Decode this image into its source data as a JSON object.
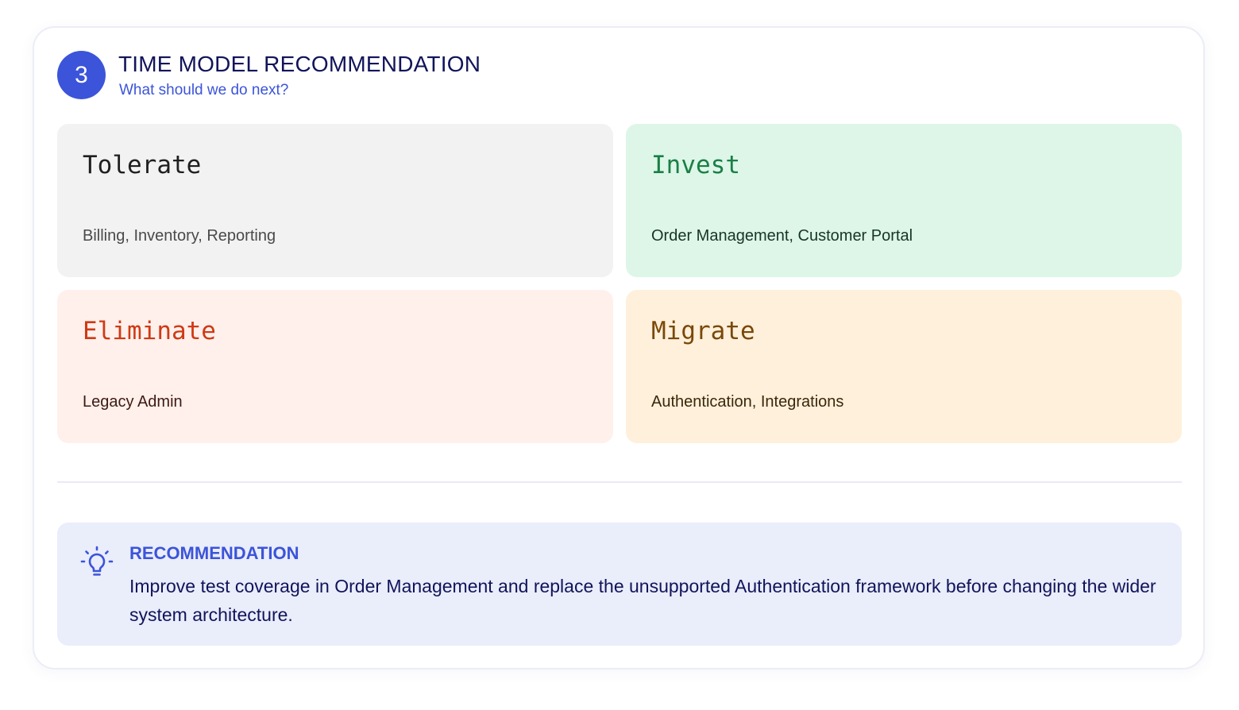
{
  "section": {
    "step_number": "3",
    "title": "TIME MODEL RECOMMENDATION",
    "subtitle": "What should we do next?"
  },
  "quadrants": [
    {
      "name": "Tolerate",
      "items": "Billing, Inventory, Reporting",
      "title_color": "#1f1f1f",
      "text_color": "#4a4a4a",
      "background": "#f2f2f2"
    },
    {
      "name": "Invest",
      "items": "Order Management, Customer Portal",
      "title_color": "#1b7f45",
      "text_color": "#173526",
      "background": "#ddf6e8"
    },
    {
      "name": "Eliminate",
      "items": "Legacy Admin",
      "title_color": "#cf3a14",
      "text_color": "#3d1a12",
      "background": "#fff0ec"
    },
    {
      "name": "Migrate",
      "items": "Authentication, Integrations",
      "title_color": "#7a4808",
      "text_color": "#3a2708",
      "background": "#fff0dc"
    }
  ],
  "recommendation": {
    "icon": "lightbulb-icon",
    "label": "RECOMMENDATION",
    "text": "Improve test coverage in Order Management and replace the unsupported Authentication framework before changing the wider system architecture."
  },
  "colors": {
    "accent": "#3b54d9",
    "heading": "#11145a"
  }
}
